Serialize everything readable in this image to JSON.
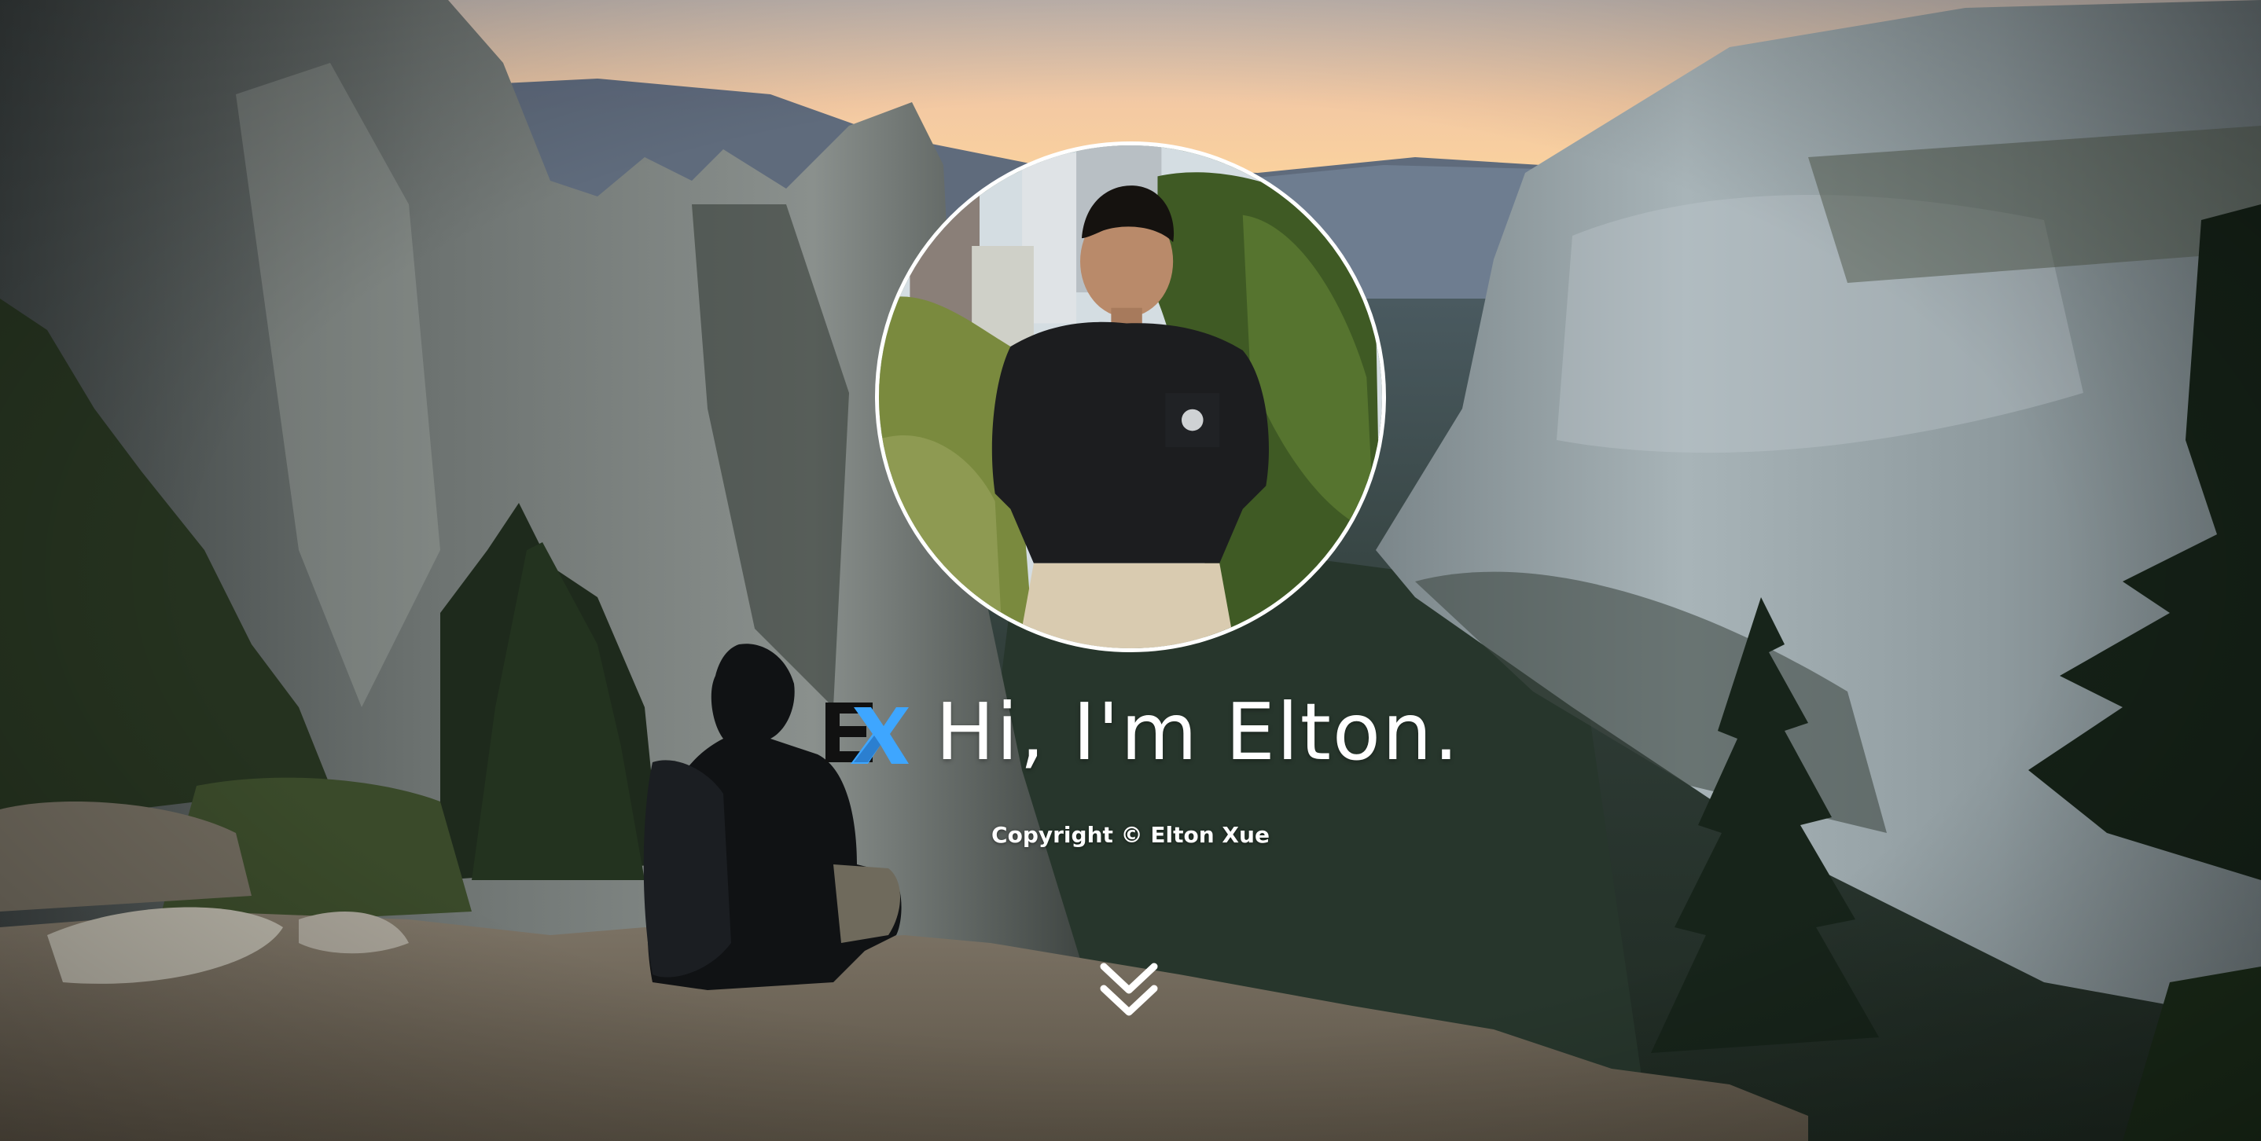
{
  "hero": {
    "greeting": "Hi, I'm Elton.",
    "copyright": "Copyright © Elton Xue",
    "logo_letters": "EX",
    "scroll_icon": "double-chevron-down-icon",
    "colors": {
      "accent_blue": "#3ea6ff",
      "logo_black": "#111111",
      "text": "#ffffff",
      "portrait_border": "#ffffff"
    }
  }
}
